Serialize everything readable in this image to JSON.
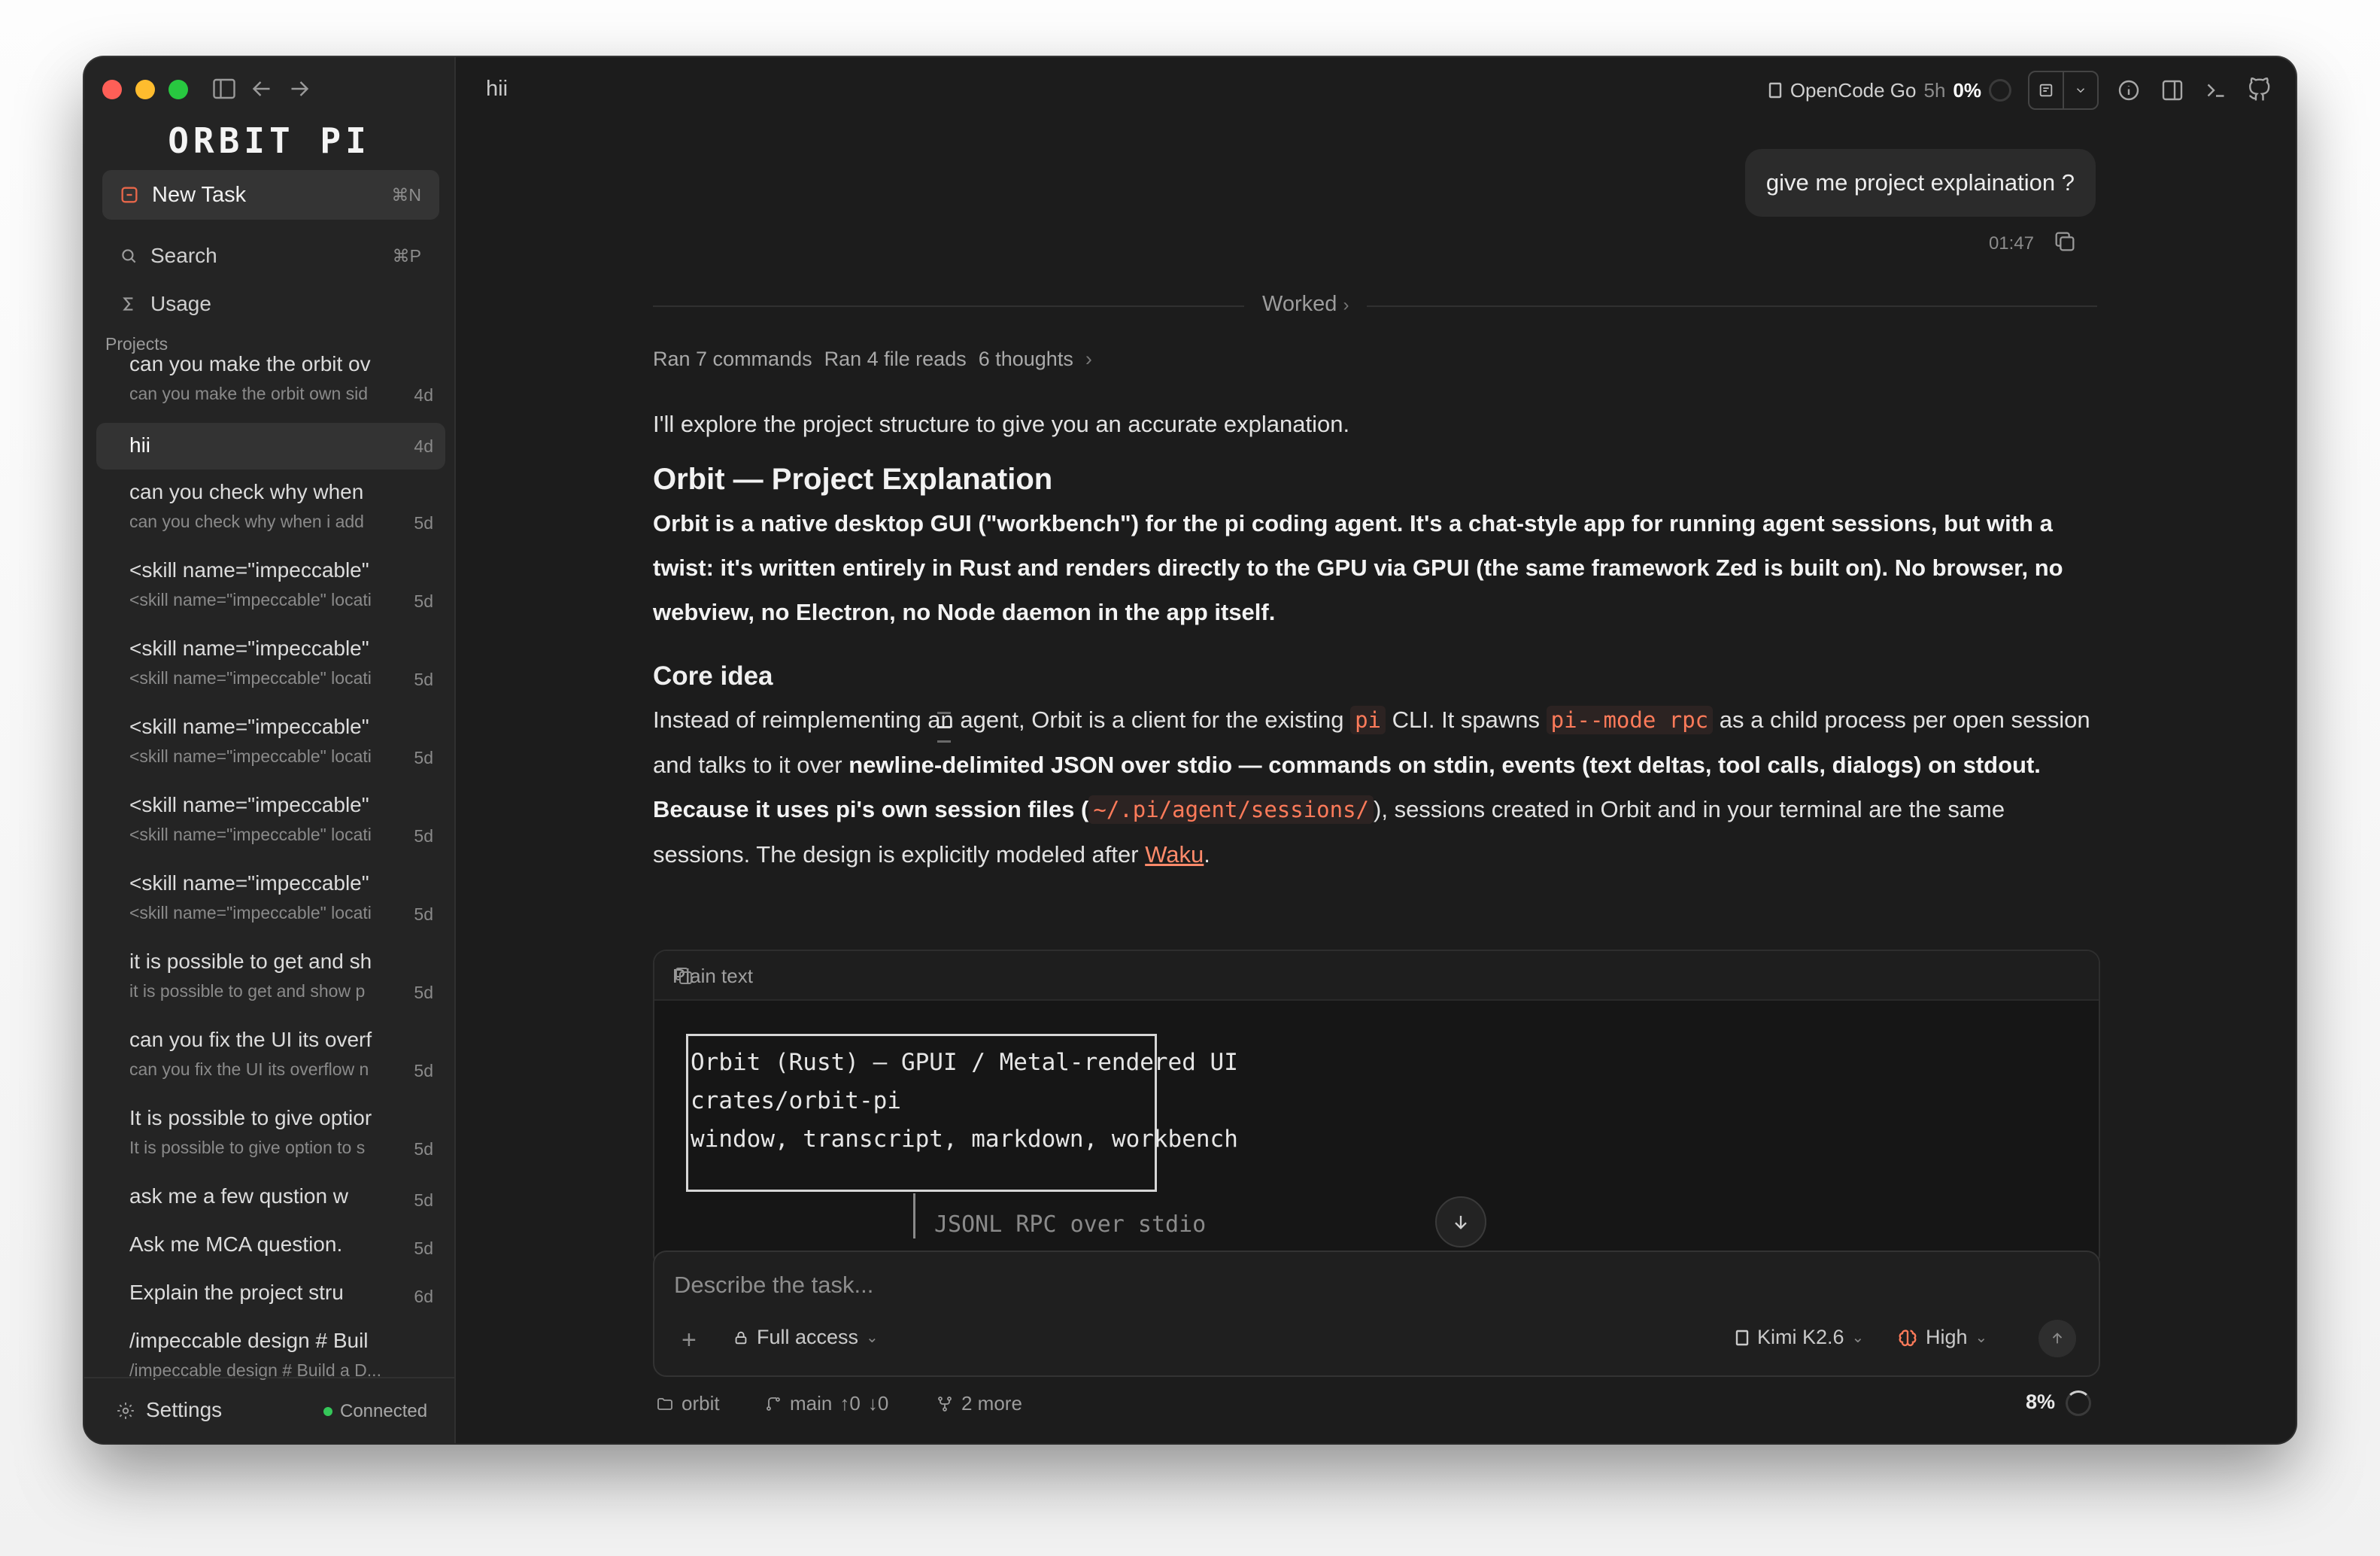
{
  "app": {
    "brand": "ORBIT PI",
    "window_title": "hii"
  },
  "sidebar": {
    "new_task": {
      "label": "New Task",
      "shortcut": "⌘N"
    },
    "search": {
      "label": "Search",
      "shortcut": "⌘P"
    },
    "usage": {
      "label": "Usage"
    },
    "projects_label": "Projects",
    "tasks": [
      {
        "title": "can you make the orbit ov",
        "preview": "can you make the orbit own sid",
        "age": "4d",
        "active": false
      },
      {
        "title": "hii",
        "preview": "",
        "age": "4d",
        "active": true
      },
      {
        "title": "can you check why when",
        "preview": "can you check why when i add",
        "age": "5d",
        "active": false
      },
      {
        "title": "<skill name=\"impeccable\"",
        "preview": "<skill name=\"impeccable\" locati",
        "age": "5d",
        "active": false
      },
      {
        "title": "<skill name=\"impeccable\"",
        "preview": "<skill name=\"impeccable\" locati",
        "age": "5d",
        "active": false
      },
      {
        "title": "<skill name=\"impeccable\"",
        "preview": "<skill name=\"impeccable\" locati",
        "age": "5d",
        "active": false
      },
      {
        "title": "<skill name=\"impeccable\"",
        "preview": "<skill name=\"impeccable\" locati",
        "age": "5d",
        "active": false
      },
      {
        "title": "<skill name=\"impeccable\"",
        "preview": "<skill name=\"impeccable\" locati",
        "age": "5d",
        "active": false
      },
      {
        "title": "it is possible to get and sh",
        "preview": "it is possible to get and show p",
        "age": "5d",
        "active": false
      },
      {
        "title": "can you fix the UI its overf",
        "preview": "can you fix the UI its overflow n",
        "age": "5d",
        "active": false
      },
      {
        "title": "It is possible to give optior",
        "preview": "It is possible to give option to s",
        "age": "5d",
        "active": false
      },
      {
        "title": "ask me a few qustion w",
        "preview": "",
        "age": "5d",
        "active": false
      },
      {
        "title": "Ask me MCA question.",
        "preview": "",
        "age": "5d",
        "active": false
      },
      {
        "title": "Explain the project stru",
        "preview": "",
        "age": "6d",
        "active": false
      },
      {
        "title": "/impeccable design # Buil",
        "preview": "/impeccable design # Build a D...",
        "age": "",
        "active": false
      }
    ],
    "footer": {
      "settings": "Settings",
      "status": "Connected"
    }
  },
  "topbar": {
    "provider": "OpenCode Go",
    "window": "5h",
    "usage_pct": "0%"
  },
  "chat": {
    "user_message": "give me project explaination ?",
    "user_time": "01:47",
    "worked_label": "Worked",
    "ran_commands": "Ran 7 commands",
    "ran_reads": "Ran 4 file reads",
    "thoughts": "6 thoughts",
    "intro": "I'll explore the project structure to give you an accurate explanation.",
    "heading": "Orbit — Project Explanation",
    "summary": "Orbit is a native desktop GUI (\"workbench\") for the pi coding agent. It's a chat-style app for running agent sessions, but with a twist: it's written entirely in Rust and renders directly to the GPU via GPUI (the same framework Zed is built on). No browser, no webview, no Electron, no Node daemon in the app itself.",
    "subheading": "Core idea",
    "core": {
      "p1": "Instead of reimplementing an agent, Orbit is a client for the existing ",
      "code1": "pi",
      "p2": " CLI. It spawns ",
      "code2": "pi--mode rpc",
      "p3": " as a child process per open session and talks to it over ",
      "bold1": "newline-delimited JSON over stdio — commands on stdin, events (text deltas, tool calls, dialogs) on stdout. Because it uses pi's own session files (",
      "code3": "~/.pi/agent/sessions/",
      "p4": "), sessions created in Orbit and in your terminal are the same sessions. The design is explicitly modeled after ",
      "link": "Waku",
      "p5": "."
    },
    "codeblock": {
      "lang": "Plain text",
      "lines": [
        "Orbit (Rust) — GPUI / Metal-rendered UI",
        "crates/orbit-pi",
        "window, transcript, markdown, workbench"
      ],
      "trailing": "JSONL RPC over stdio"
    }
  },
  "composer": {
    "placeholder": "Describe the task...",
    "access": "Full access",
    "model": "Kimi K2.6",
    "effort": "High"
  },
  "statusbar": {
    "folder": "orbit",
    "branch": "main",
    "ahead": "↑0",
    "behind": "↓0",
    "worktrees": "2 more",
    "context_pct": "8%"
  },
  "colors": {
    "accent": "#ff7b5a",
    "connected": "#35c759"
  }
}
